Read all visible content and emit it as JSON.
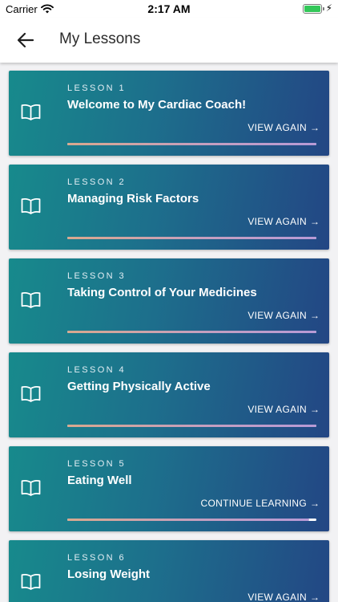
{
  "status_bar": {
    "carrier": "Carrier",
    "time": "2:17 AM"
  },
  "header": {
    "title": "My Lessons"
  },
  "lessons": [
    {
      "number": "LESSON 1",
      "title": "Welcome to My Cardiac Coach!",
      "action": "VIEW AGAIN",
      "progress": 1.0
    },
    {
      "number": "LESSON 2",
      "title": "Managing Risk Factors",
      "action": "VIEW AGAIN",
      "progress": 1.0
    },
    {
      "number": "LESSON 3",
      "title": "Taking Control of Your Medicines",
      "action": "VIEW AGAIN",
      "progress": 1.0
    },
    {
      "number": "LESSON 4",
      "title": "Getting Physically Active",
      "action": "VIEW AGAIN",
      "progress": 1.0
    },
    {
      "number": "LESSON 5",
      "title": "Eating Well",
      "action": "CONTINUE LEARNING",
      "progress": 0.97
    },
    {
      "number": "LESSON 6",
      "title": "Losing Weight",
      "action": "VIEW AGAIN",
      "progress": 1.0
    }
  ],
  "colors": {
    "card_start": "#178a8c",
    "card_end": "#234684",
    "progress_start": "#d9a88e",
    "progress_end": "#b79ad6",
    "battery": "#33c759"
  },
  "icons": {
    "back": "arrow-left-icon",
    "lesson": "book-icon",
    "action": "arrow-right-icon"
  }
}
